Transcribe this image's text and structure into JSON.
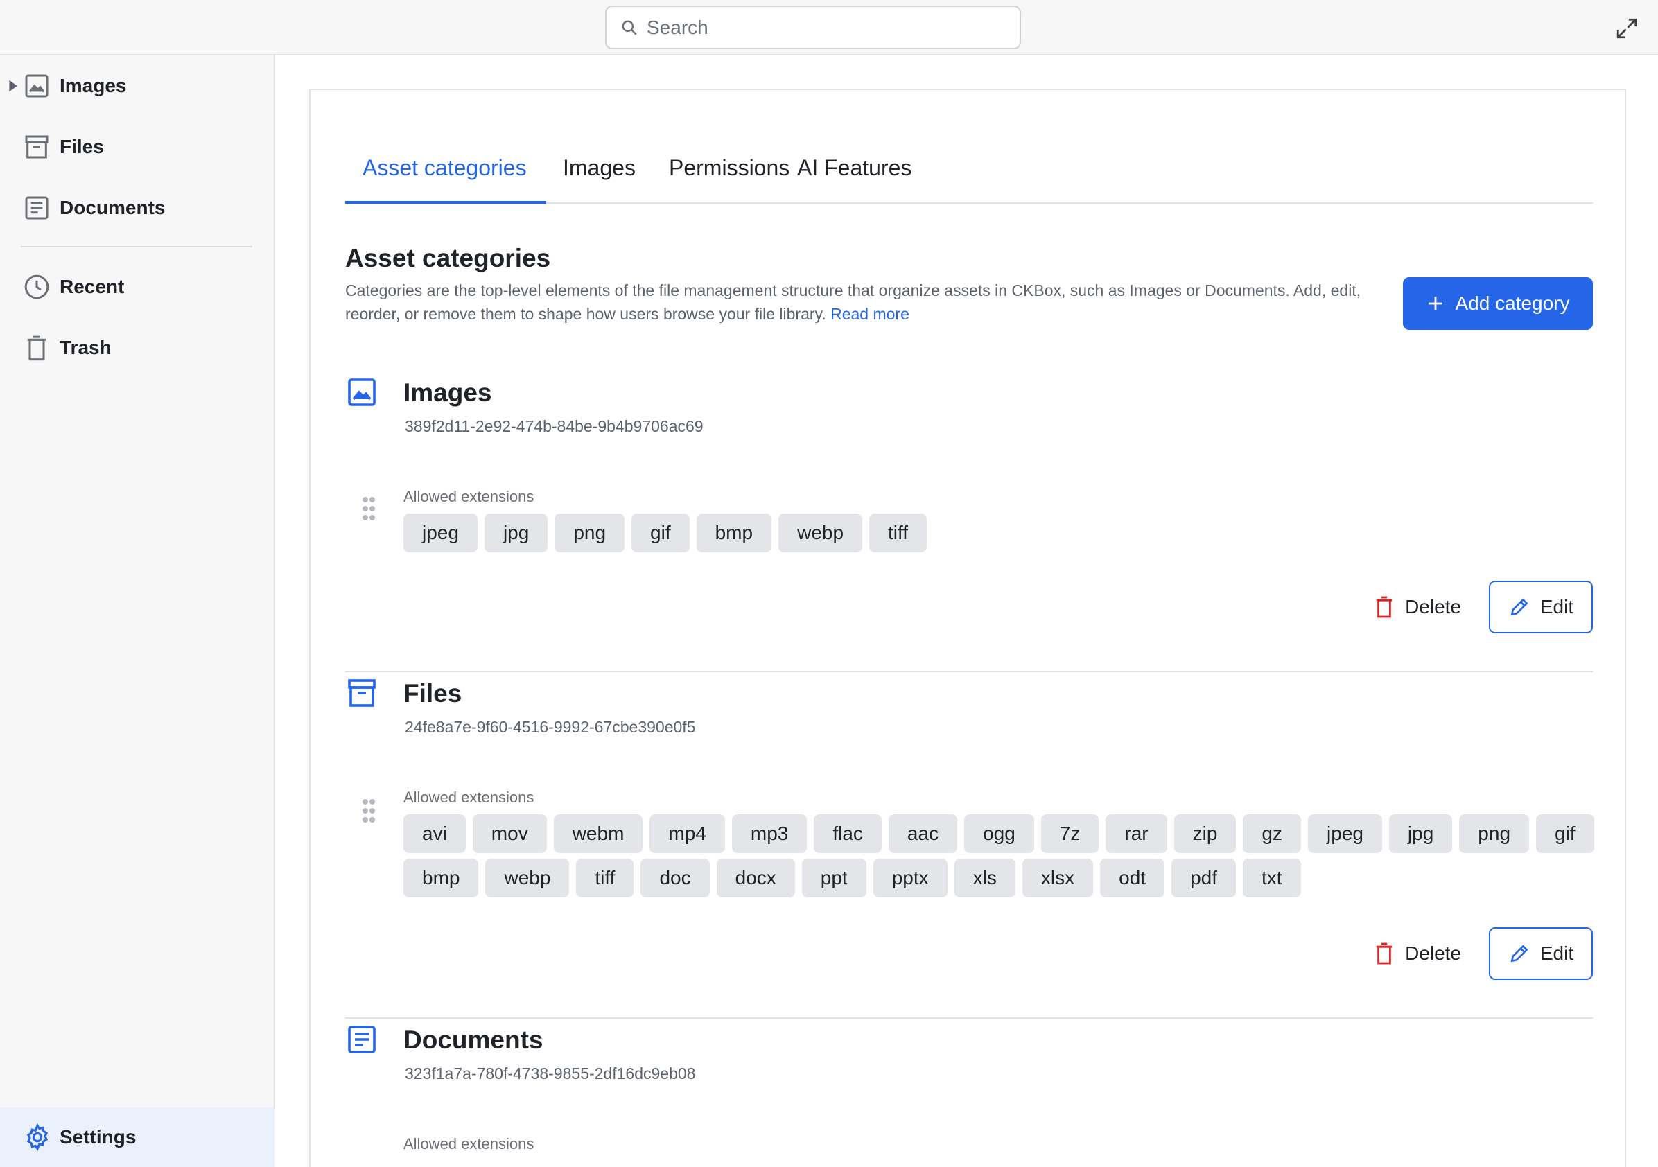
{
  "search": {
    "placeholder": "Search"
  },
  "sidebar": {
    "items": [
      {
        "label": "Images",
        "icon": "image-icon"
      },
      {
        "label": "Files",
        "icon": "archive-icon"
      },
      {
        "label": "Documents",
        "icon": "document-icon"
      },
      {
        "label": "Recent",
        "icon": "clock-icon"
      },
      {
        "label": "Trash",
        "icon": "trash-icon"
      }
    ],
    "settings_label": "Settings"
  },
  "tabs": [
    {
      "label": "Asset categories",
      "active": true
    },
    {
      "label": "Images"
    },
    {
      "label": "Permissions"
    },
    {
      "label": "AI Features"
    }
  ],
  "section": {
    "title": "Asset categories",
    "description": "Categories are the top-level elements of the file management structure that organize assets in CKBox, such as Images or Documents. Add, edit, reorder, or remove them to shape how users browse your file library.",
    "read_more": "Read more",
    "add_button": "Add category"
  },
  "categories": [
    {
      "name": "Images",
      "id": "389f2d11-2e92-474b-84be-9b4b9706ac69",
      "ext_label": "Allowed extensions",
      "extensions": [
        "jpeg",
        "jpg",
        "png",
        "gif",
        "bmp",
        "webp",
        "tiff"
      ],
      "delete_label": "Delete",
      "edit_label": "Edit"
    },
    {
      "name": "Files",
      "id": "24fe8a7e-9f60-4516-9992-67cbe390e0f5",
      "ext_label": "Allowed extensions",
      "extensions": [
        "avi",
        "mov",
        "webm",
        "mp4",
        "mp3",
        "flac",
        "aac",
        "ogg",
        "7z",
        "rar",
        "zip",
        "gz",
        "jpeg",
        "jpg",
        "png",
        "gif",
        "bmp",
        "webp",
        "tiff",
        "doc",
        "docx",
        "ppt",
        "pptx",
        "xls",
        "xlsx",
        "odt",
        "pdf",
        "txt"
      ],
      "delete_label": "Delete",
      "edit_label": "Edit"
    },
    {
      "name": "Documents",
      "id": "323f1a7a-780f-4738-9855-2df16dc9eb08",
      "ext_label": "Allowed extensions"
    }
  ],
  "colors": {
    "accent": "#2566e8",
    "danger": "#e02424"
  }
}
